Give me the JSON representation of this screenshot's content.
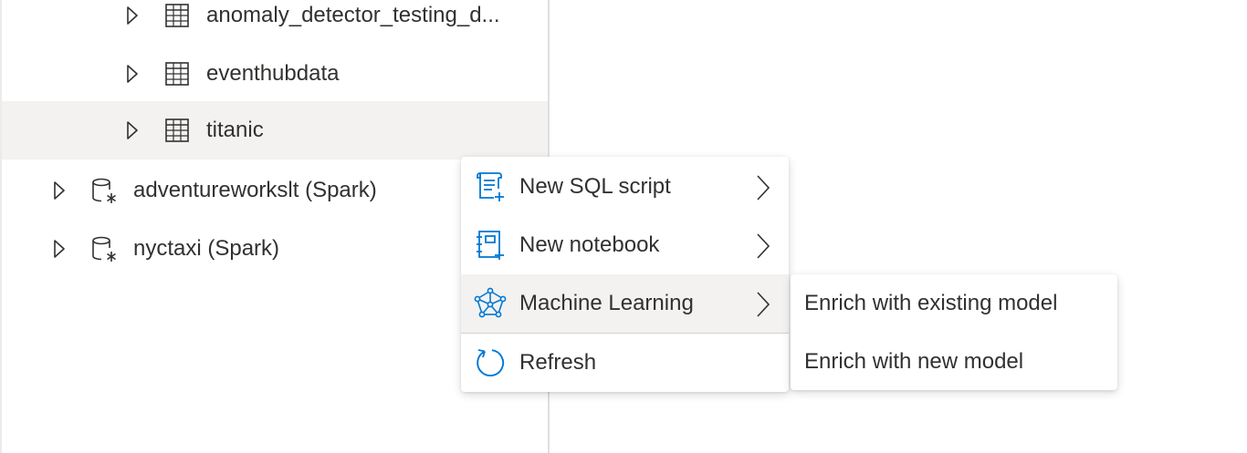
{
  "tree": {
    "items": [
      {
        "label": "anomaly_detector_testing_d...",
        "icon": "table-icon",
        "level": 2,
        "expanded": false,
        "selected": false
      },
      {
        "label": "eventhubdata",
        "icon": "table-icon",
        "level": 2,
        "expanded": false,
        "selected": false
      },
      {
        "label": "titanic",
        "icon": "table-icon",
        "level": 2,
        "expanded": false,
        "selected": true
      },
      {
        "label": "adventureworkslt (Spark)",
        "icon": "spark-database-icon",
        "level": 1,
        "expanded": false,
        "selected": false
      },
      {
        "label": "nyctaxi (Spark)",
        "icon": "spark-database-icon",
        "level": 1,
        "expanded": false,
        "selected": false
      }
    ]
  },
  "context_menu": {
    "items": [
      {
        "label": "New SQL script",
        "icon": "sql-script-icon",
        "has_submenu": true
      },
      {
        "label": "New notebook",
        "icon": "notebook-icon",
        "has_submenu": true
      },
      {
        "label": "Machine Learning",
        "icon": "machine-learning-icon",
        "has_submenu": true,
        "active": true
      },
      {
        "label": "Refresh",
        "icon": "refresh-icon",
        "has_submenu": false
      }
    ]
  },
  "submenu": {
    "items": [
      {
        "label": "Enrich with existing model"
      },
      {
        "label": "Enrich with new model"
      }
    ]
  },
  "colors": {
    "icon_blue": "#0078d4",
    "icon_dark": "#323130",
    "selected_row": "#f3f2f1",
    "divider": "#e1dfdd"
  }
}
